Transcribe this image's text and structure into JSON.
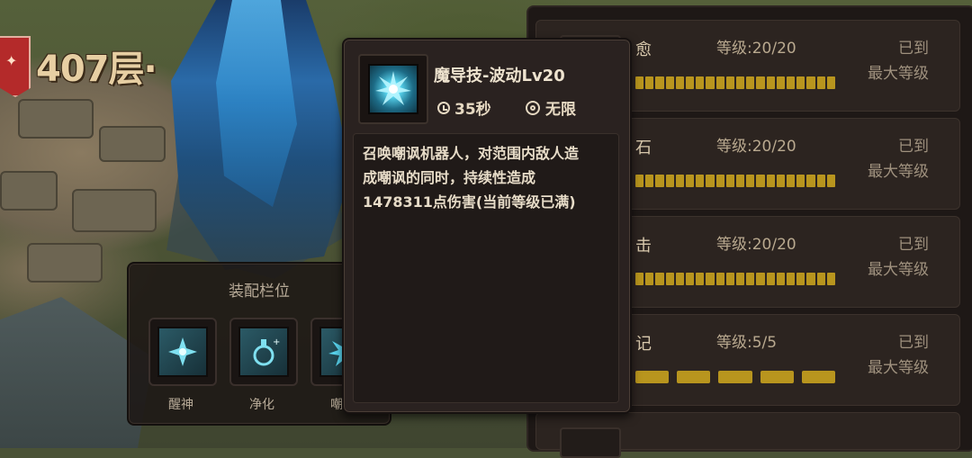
{
  "hud": {
    "floor": "407层·"
  },
  "tooltip": {
    "skill_name": "魔导技-波动Lv20",
    "cooldown": "35秒",
    "range": "无限",
    "description_lines": [
      "召唤嘲讽机器人，对范围内敌人造",
      "成嘲讽的同时，持续性造成",
      "1478311点伤害(当前等级已满)"
    ]
  },
  "equip_panel": {
    "title": "装配栏位",
    "slots": [
      {
        "label": "醒神",
        "icon": "awaken-sparkle-icon"
      },
      {
        "label": "净化",
        "icon": "purify-flask-icon"
      },
      {
        "label": "嘲讽",
        "icon": "taunt-burst-icon"
      }
    ]
  },
  "skill_list": [
    {
      "name_fragment": "愈",
      "level": "等级:20/20",
      "max_line1": "已到",
      "max_line2": "最大等级",
      "progress": 1.0
    },
    {
      "name_fragment": "石",
      "level": "等级:20/20",
      "max_line1": "已到",
      "max_line2": "最大等级",
      "progress": 1.0
    },
    {
      "name_fragment": "击",
      "level": "等级:20/20",
      "max_line1": "已到",
      "max_line2": "最大等级",
      "progress": 1.0
    },
    {
      "name_fragment": "记",
      "level": "等级:5/5",
      "max_line1": "已到",
      "max_line2": "最大等级",
      "progress": 1.0
    }
  ],
  "colors": {
    "bar_fill": "#b8951e",
    "panel_bg": "#2a2220",
    "skill_icon_cyan": "#59d6f0"
  }
}
